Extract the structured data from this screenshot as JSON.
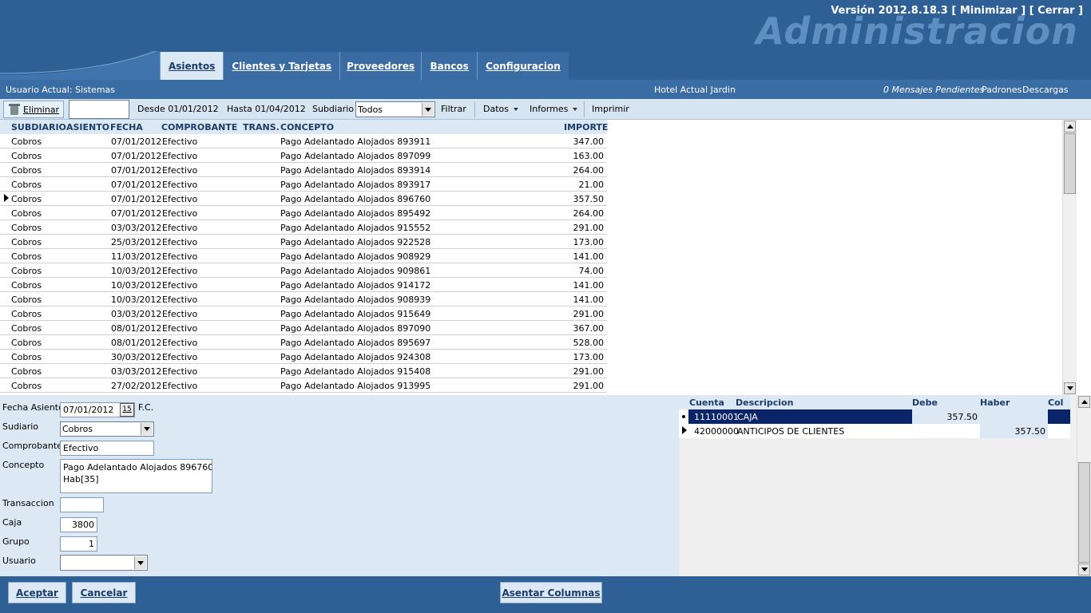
{
  "header": {
    "version_text": "Versión 2012.8.18.3  [ Minimizar ] [ Cerrar ]",
    "brand": "Administracion",
    "tabs": [
      "Asientos",
      "Clientes y Tarjetas",
      "Proveedores",
      "Bancos",
      "Configuracion"
    ]
  },
  "status": {
    "user": "Usuario Actual: Sistemas",
    "hotel": "Hotel Actual Jardin",
    "messages": "0 Mensajes Pendientes",
    "padrones": "Padrones",
    "descargas": "Descargas"
  },
  "toolbar": {
    "eliminar": "Eliminar",
    "desde": "Desde 01/01/2012",
    "hasta": "Hasta 01/04/2012",
    "subdiario_label": "Subdiario",
    "subdiario_value": "Todos",
    "filtrar": "Filtrar",
    "datos": "Datos",
    "informes": "Informes",
    "imprimir": "Imprimir"
  },
  "grid": {
    "columns": [
      "SUBDIARIO",
      "ASIENTO",
      "FECHA",
      "COMPROBANTE",
      "TRANS.",
      "CONCEPTO",
      "IMPORTE"
    ],
    "rows": [
      [
        "Cobros",
        "07/01/2012",
        "Efectivo",
        "Pago Adelantado Alojados 893911",
        "347.00"
      ],
      [
        "Cobros",
        "07/01/2012",
        "Efectivo",
        "Pago Adelantado Alojados 897099",
        "163.00"
      ],
      [
        "Cobros",
        "07/01/2012",
        "Efectivo",
        "Pago Adelantado Alojados 893914",
        "264.00"
      ],
      [
        "Cobros",
        "07/01/2012",
        "Efectivo",
        "Pago Adelantado Alojados 893917",
        "21.00"
      ],
      [
        "Cobros",
        "07/01/2012",
        "Efectivo",
        "Pago Adelantado Alojados 896760",
        "357.50"
      ],
      [
        "Cobros",
        "07/01/2012",
        "Efectivo",
        "Pago Adelantado Alojados 895492",
        "264.00"
      ],
      [
        "Cobros",
        "03/03/2012",
        "Efectivo",
        "Pago Adelantado Alojados 915552",
        "291.00"
      ],
      [
        "Cobros",
        "25/03/2012",
        "Efectivo",
        "Pago Adelantado Alojados 922528",
        "173.00"
      ],
      [
        "Cobros",
        "11/03/2012",
        "Efectivo",
        "Pago Adelantado Alojados 908929",
        "141.00"
      ],
      [
        "Cobros",
        "10/03/2012",
        "Efectivo",
        "Pago Adelantado Alojados 909861",
        "74.00"
      ],
      [
        "Cobros",
        "10/03/2012",
        "Efectivo",
        "Pago Adelantado Alojados 914172",
        "141.00"
      ],
      [
        "Cobros",
        "10/03/2012",
        "Efectivo",
        "Pago Adelantado Alojados 908939",
        "141.00"
      ],
      [
        "Cobros",
        "03/03/2012",
        "Efectivo",
        "Pago Adelantado Alojados 915649",
        "291.00"
      ],
      [
        "Cobros",
        "08/01/2012",
        "Efectivo",
        "Pago Adelantado Alojados 897090",
        "367.00"
      ],
      [
        "Cobros",
        "08/01/2012",
        "Efectivo",
        "Pago Adelantado Alojados 895697",
        "528.00"
      ],
      [
        "Cobros",
        "30/03/2012",
        "Efectivo",
        "Pago Adelantado Alojados 924308",
        "173.00"
      ],
      [
        "Cobros",
        "03/03/2012",
        "Efectivo",
        "Pago Adelantado Alojados 915408",
        "291.00"
      ],
      [
        "Cobros",
        "27/02/2012",
        "Efectivo",
        "Pago Adelantado Alojados 913995",
        "291.00"
      ]
    ]
  },
  "form": {
    "fecha_label": "Fecha Asiento",
    "fecha_value": "07/01/2012",
    "fecha_btn": "15",
    "fc": "F.C.",
    "subdiario_label": "Sudiario",
    "subdiario_value": "Cobros",
    "comprobante_label": "Comprobante",
    "comprobante_value": "Efectivo",
    "concepto_label": "Concepto",
    "concepto_line1": "Pago Adelantado Alojados 896760",
    "concepto_line2": "Hab[35]",
    "transaccion_label": "Transaccion",
    "transaccion_value": "",
    "caja_label": "Caja",
    "caja_value": "3800",
    "grupo_label": "Grupo",
    "grupo_value": "1",
    "usuario_label": "Usuario",
    "usuario_value": ""
  },
  "accounts": {
    "columns": [
      "Cuenta",
      "Descripcion",
      "Debe",
      "Haber",
      "Col"
    ],
    "rows": [
      {
        "cuenta": "11110001",
        "descripcion": "CAJA",
        "debe": "357.50",
        "haber": ""
      },
      {
        "cuenta": "42000000",
        "descripcion": "ANTICIPOS DE CLIENTES",
        "debe": "",
        "haber": "357.50"
      }
    ]
  },
  "footer": {
    "aceptar": "Aceptar",
    "cancelar": "Cancelar",
    "asentar": "Asentar Columnas"
  },
  "colors": {
    "header_bg": "#2e5f95",
    "panel_bg": "#dce8f3",
    "selected_row": "#0a246a"
  }
}
